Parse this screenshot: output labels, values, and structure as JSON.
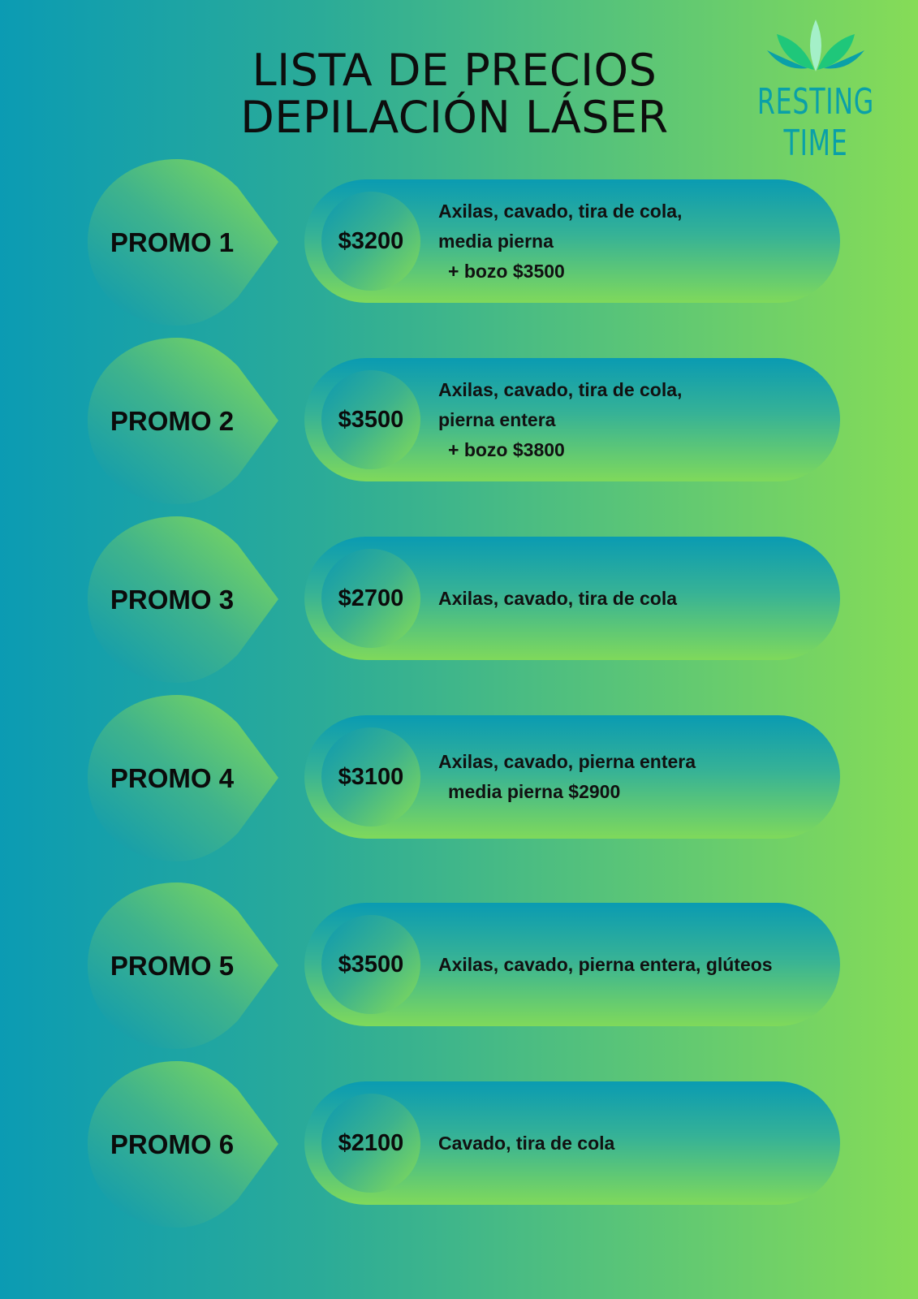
{
  "title": {
    "line1": "LISTA DE PRECIOS",
    "line2": "DEPILACIÓN LÁSER"
  },
  "logo": {
    "text": "RESTING TIME",
    "icon": "lotus-leaves-icon",
    "colors": [
      "#0aa0a8",
      "#1fc77a",
      "#a4f0c8"
    ]
  },
  "promos": [
    {
      "label": "PROMO 1",
      "price": "$3200",
      "lines": [
        "Axilas, cavado, tira de cola,",
        "media pierna"
      ],
      "extra": "+ bozo $3500"
    },
    {
      "label": "PROMO 2",
      "price": "$3500",
      "lines": [
        "Axilas, cavado, tira de cola,",
        "pierna entera"
      ],
      "extra": "+ bozo $3800"
    },
    {
      "label": "PROMO 3",
      "price": "$2700",
      "lines": [
        "Axilas, cavado, tira de cola"
      ],
      "extra": ""
    },
    {
      "label": "PROMO 4",
      "price": "$3100",
      "lines": [
        "Axilas, cavado, pierna entera"
      ],
      "extra": "media pierna $2900"
    },
    {
      "label": "PROMO 5",
      "price": "$3500",
      "lines": [
        "Axilas, cavado, pierna entera, glúteos"
      ],
      "extra": ""
    },
    {
      "label": "PROMO 6",
      "price": "$2100",
      "lines": [
        "Cavado, tira de cola"
      ],
      "extra": ""
    }
  ]
}
